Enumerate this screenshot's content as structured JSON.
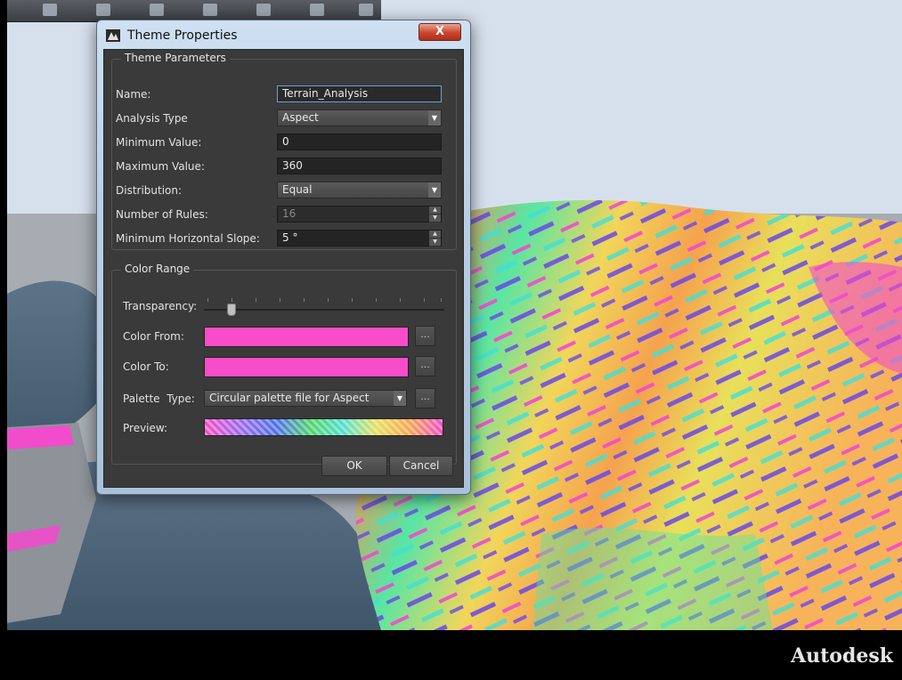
{
  "dialog": {
    "title": "Theme Properties",
    "close_glyph": "X",
    "theme_parameters": {
      "title": "Theme Parameters",
      "name_label": "Name:",
      "name_value": "Terrain_Analysis",
      "analysis_type_label": "Analysis Type",
      "analysis_type_value": "Aspect",
      "min_value_label": "Minimum Value:",
      "min_value": "0",
      "max_value_label": "Maximum Value:",
      "max_value": "360",
      "distribution_label": "Distribution:",
      "distribution_value": "Equal",
      "rules_label": "Number of Rules:",
      "rules_value": "16",
      "slope_label": "Minimum Horizontal Slope:",
      "slope_value": "5 °"
    },
    "color_range": {
      "title": "Color Range",
      "transparency_label": "Transparency:",
      "transparency_level": 0.1,
      "color_from_label": "Color From:",
      "color_from": "#f84dc9",
      "color_to_label": "Color To:",
      "color_to": "#f84dc9",
      "palette_type_label": "Palette  Type:",
      "palette_type_value": "Circular palette file for Aspect",
      "preview_label": "Preview:",
      "browse_label": "..."
    },
    "buttons": {
      "ok": "OK",
      "cancel": "Cancel"
    }
  },
  "brand": "Autodesk"
}
